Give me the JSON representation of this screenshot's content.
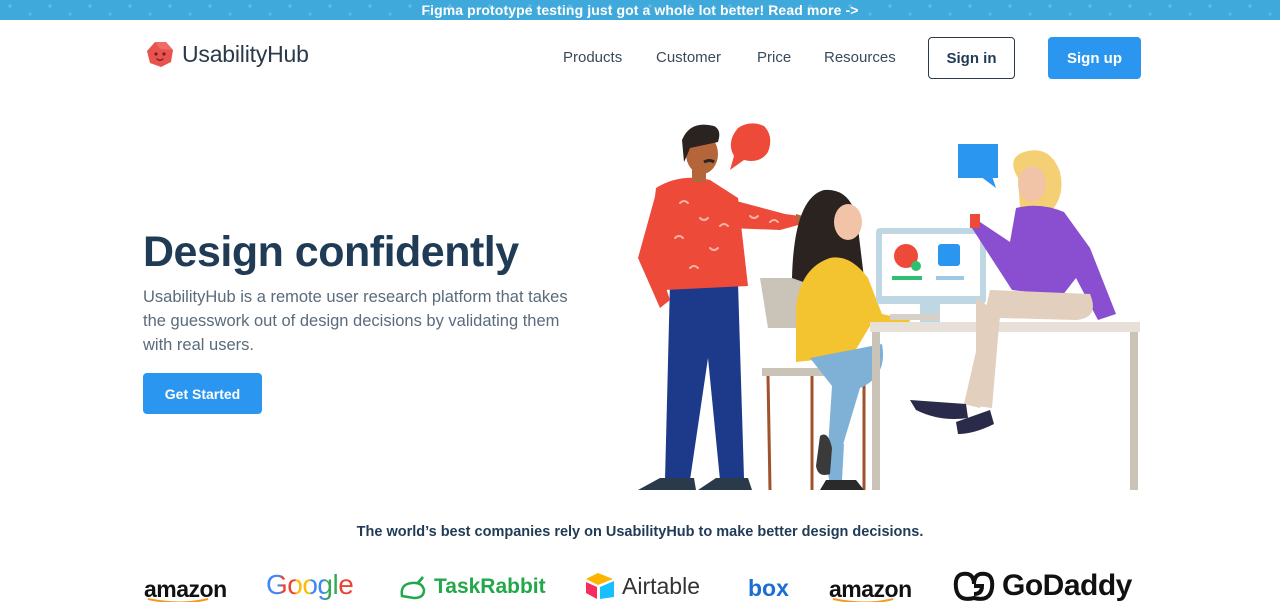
{
  "banner": {
    "text": "Figma prototype testing just got a whole lot better! Read more ->"
  },
  "header": {
    "brand": "UsabilityHub",
    "nav": [
      {
        "label": "Products"
      },
      {
        "label": "Customer"
      },
      {
        "label": "Price"
      },
      {
        "label": "Resources"
      }
    ],
    "signin_label": "Sign in",
    "signup_label": "Sign up"
  },
  "hero": {
    "title": "Design confidently",
    "subtitle": "UsabilityHub is a remote user research platform that takes the guesswork out of design decisions by validating them with real users.",
    "cta_label": "Get Started"
  },
  "trust": {
    "headline": "The world’s best companies rely on UsabilityHub to make better design decisions.",
    "companies": [
      {
        "name": "amazon"
      },
      {
        "name": "Google"
      },
      {
        "name": "TaskRabbit"
      },
      {
        "name": "Airtable"
      },
      {
        "name": "box"
      },
      {
        "name": "amazon"
      },
      {
        "name": "GoDaddy"
      }
    ]
  },
  "colors": {
    "banner": "#3fa9dc",
    "primary": "#2b96ef",
    "heading": "#1f3b55",
    "body_text": "#5a6b7b"
  }
}
